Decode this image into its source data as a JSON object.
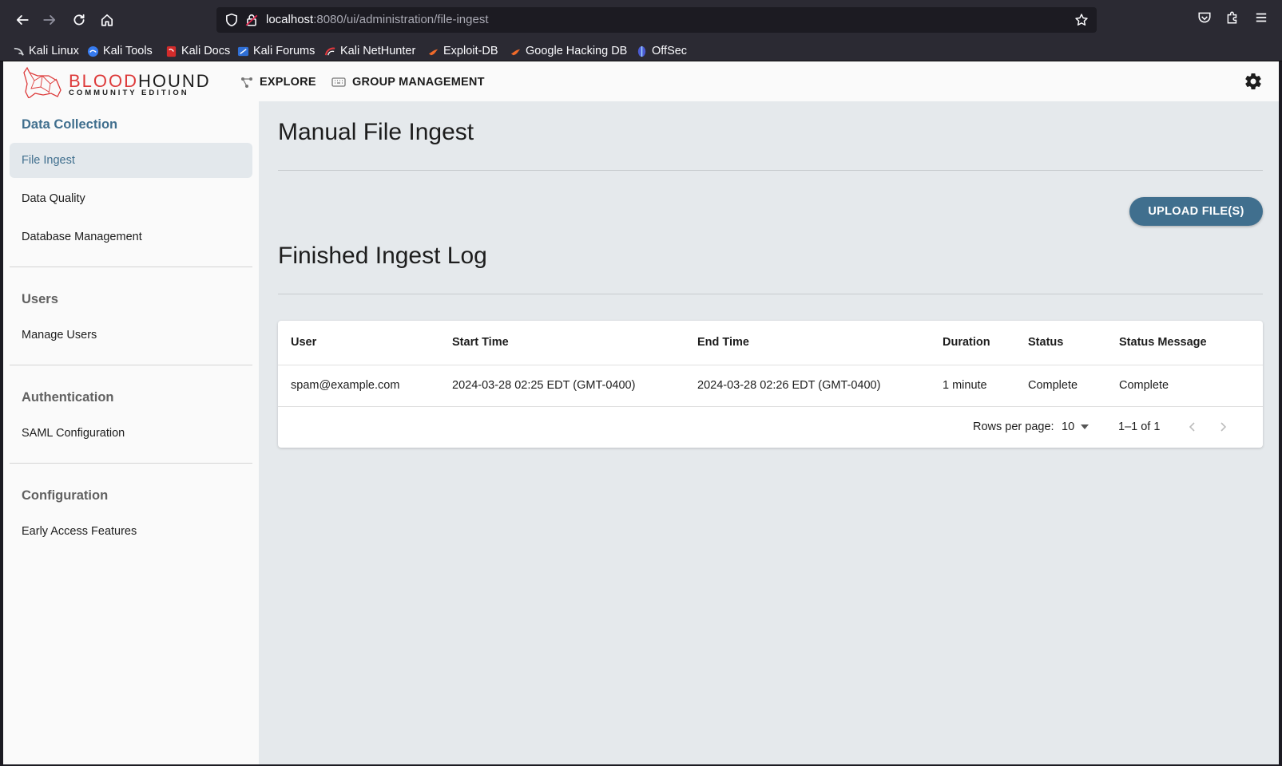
{
  "browser": {
    "url_host": "localhost",
    "url_path": ":8080/ui/administration/file-ingest",
    "bookmarks": [
      {
        "label": "Kali Linux",
        "icon": "kali-dragon-icon"
      },
      {
        "label": "Kali Tools",
        "icon": "kali-tools-icon"
      },
      {
        "label": "Kali Docs",
        "icon": "kali-docs-icon"
      },
      {
        "label": "Kali Forums",
        "icon": "kali-forums-icon"
      },
      {
        "label": "Kali NetHunter",
        "icon": "kali-nethunter-icon"
      },
      {
        "label": "Exploit-DB",
        "icon": "exploit-db-icon"
      },
      {
        "label": "Google Hacking DB",
        "icon": "ghdb-icon"
      },
      {
        "label": "OffSec",
        "icon": "offsec-icon"
      }
    ]
  },
  "header": {
    "logo_word_a": "BLOOD",
    "logo_word_b": "HOUND",
    "logo_sub": "COMMUNITY EDITION",
    "nav": [
      {
        "label": "EXPLORE",
        "icon": "explore-graph-icon"
      },
      {
        "label": "GROUP MANAGEMENT",
        "icon": "keyboard-icon"
      }
    ],
    "settings_icon": "gear-icon"
  },
  "sidebar": {
    "sections": [
      {
        "title": "Data Collection",
        "items": [
          "File Ingest",
          "Data Quality",
          "Database Management"
        ]
      },
      {
        "title": "Users",
        "items": [
          "Manage Users"
        ]
      },
      {
        "title": "Authentication",
        "items": [
          "SAML Configuration"
        ]
      },
      {
        "title": "Configuration",
        "items": [
          "Early Access Features"
        ]
      }
    ],
    "selected": "File Ingest"
  },
  "main": {
    "title": "Manual File Ingest",
    "upload_label": "UPLOAD FILE(S)",
    "log_title": "Finished Ingest Log",
    "table": {
      "columns": [
        "User",
        "Start Time",
        "End Time",
        "Duration",
        "Status",
        "Status Message"
      ],
      "rows": [
        [
          "spam@example.com",
          "2024-03-28 02:25 EDT (GMT-0400)",
          "2024-03-28 02:26 EDT (GMT-0400)",
          "1 minute",
          "Complete",
          "Complete"
        ]
      ],
      "rows_per_page_label": "Rows per page:",
      "rows_per_page": "10",
      "range_label": "1–1 of 1"
    }
  },
  "colors": {
    "accent": "#406f8e",
    "brand_red": "#dd3a3a",
    "content_bg": "#e5e9ec",
    "browser_chrome": "#2b2a33"
  }
}
